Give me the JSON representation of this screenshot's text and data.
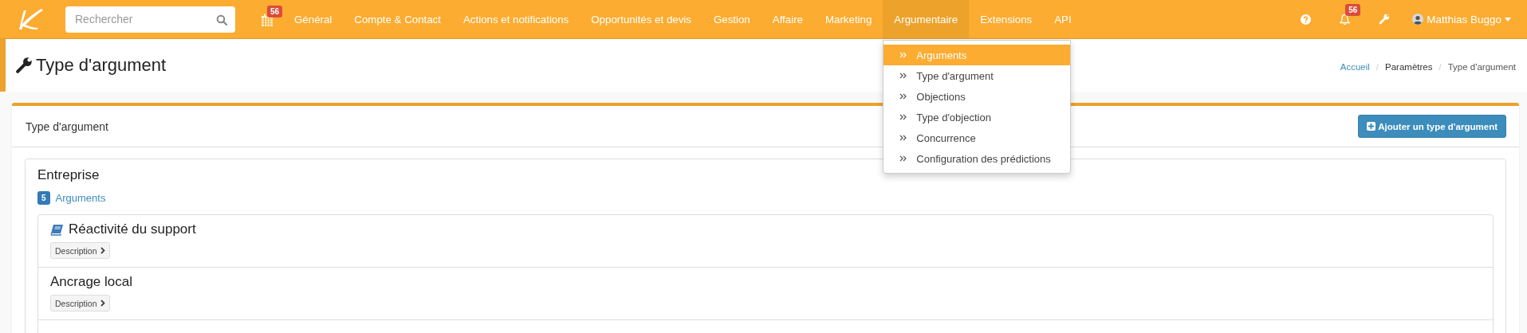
{
  "navbar": {
    "search": {
      "placeholder": "Rechercher"
    },
    "calendar_badge": "56",
    "menu": [
      {
        "label": "Général",
        "selected": false
      },
      {
        "label": "Compte & Contact",
        "selected": false
      },
      {
        "label": "Actions et notifications",
        "selected": false
      },
      {
        "label": "Opportunités et devis",
        "selected": false
      },
      {
        "label": "Gestion",
        "selected": false
      },
      {
        "label": "Affaire",
        "selected": false
      },
      {
        "label": "Marketing",
        "selected": false
      },
      {
        "label": "Argumentaire",
        "selected": true,
        "dropdown": [
          {
            "label": "Arguments",
            "selected": true
          },
          {
            "label": "Type d'argument",
            "selected": false
          },
          {
            "label": "Objections",
            "selected": false
          },
          {
            "label": "Type d'objection",
            "selected": false
          },
          {
            "label": "Concurrence",
            "selected": false
          },
          {
            "label": "Configuration des prédictions",
            "selected": false
          }
        ]
      },
      {
        "label": "Extensions",
        "selected": false
      },
      {
        "label": "API",
        "selected": false
      }
    ],
    "notification_badge": "56",
    "user": "Matthias Buggo"
  },
  "page_title": "Type d'argument",
  "breadcrumb": [
    {
      "label": "Accueil"
    },
    {
      "separator": "/",
      "label": "Paramètres"
    },
    {
      "separator": "/",
      "label": "Type d'argument"
    }
  ],
  "card": {
    "title": "Type d'argument",
    "add_button": "Ajouter un type d'argument",
    "group": {
      "name": "Entreprise",
      "count": "5",
      "link": "Arguments",
      "arguments": [
        {
          "title": "Réactivité du support",
          "has_icon": true,
          "button": "Description"
        },
        {
          "title": "Ancrage local",
          "has_icon": false,
          "button": "Description"
        }
      ]
    }
  }
}
